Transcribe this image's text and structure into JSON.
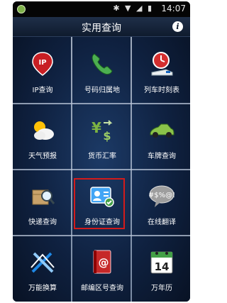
{
  "status_bar": {
    "time": "14:07"
  },
  "title_bar": {
    "title": "实用查询",
    "info_label": "i"
  },
  "grid": {
    "items": [
      {
        "label": "IP查询",
        "icon": "ip-pin-icon"
      },
      {
        "label": "号码归属地",
        "icon": "phone-handset-icon"
      },
      {
        "label": "列车时刻表",
        "icon": "train-clock-icon"
      },
      {
        "label": "天气预报",
        "icon": "weather-icon"
      },
      {
        "label": "货币汇率",
        "icon": "currency-exchange-icon"
      },
      {
        "label": "车牌查询",
        "icon": "car-icon"
      },
      {
        "label": "快递查询",
        "icon": "parcel-search-icon"
      },
      {
        "label": "身份证查询",
        "icon": "id-card-icon"
      },
      {
        "label": "在线翻译",
        "icon": "translate-bubble-icon"
      },
      {
        "label": "万能换算",
        "icon": "tools-icon"
      },
      {
        "label": "邮编区号查询",
        "icon": "postal-book-icon"
      },
      {
        "label": "万年历",
        "icon": "calendar-icon",
        "calendar_day": "14"
      }
    ]
  },
  "colors": {
    "highlight": "#d21b1b",
    "background": "#0f2140"
  }
}
